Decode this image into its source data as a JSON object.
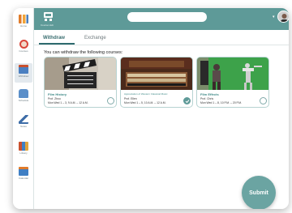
{
  "sidebar": {
    "items": [
      {
        "label": "Home",
        "icon": "bar-chart-icon",
        "color": "#e07b2a"
      },
      {
        "label": "Courses",
        "icon": "compass-icon",
        "color": "#d9463a"
      },
      {
        "label": "Withdraw",
        "icon": "calendar-icon",
        "color": "#4a7fc1"
      },
      {
        "label": "Schedule",
        "icon": "desk-icon",
        "color": "#5b8fc9"
      },
      {
        "label": "Notes",
        "icon": "pencil-icon",
        "color": "#3f6ea8"
      },
      {
        "label": "Library",
        "icon": "books-icon",
        "color": "#c9502e"
      },
      {
        "label": "Calendar",
        "icon": "planner-icon",
        "color": "#3f7fc4"
      }
    ]
  },
  "topbar": {
    "app_label": "Course Hub",
    "search_placeholder": "",
    "avatar_icon": "user-avatar-icon",
    "bg": "#5e9a98"
  },
  "tabs": [
    {
      "label": "Withdraw",
      "active": true
    },
    {
      "label": "Exchange",
      "active": false
    }
  ],
  "instruction": "You can withdraw the following courses:",
  "courses": [
    {
      "title": "Film History",
      "prof": "Prof. Zhou",
      "time": "Mon    Wed 1 – 3, 9 A.M. – 12 A.M.",
      "selected": false
    },
    {
      "title": "Appreciation of Western Classical Music",
      "prof": "Prof. Ellen",
      "time": "Mon    Wed 1 – 5, 10 A.M. – 12 A.M.",
      "selected": true
    },
    {
      "title": "Film Effects",
      "prof": "Prof. Chris",
      "time": "Mon    Wed 1 – 8, 10 P.M. – 20 P.M.",
      "selected": false
    }
  ],
  "submit_label": "Submit"
}
